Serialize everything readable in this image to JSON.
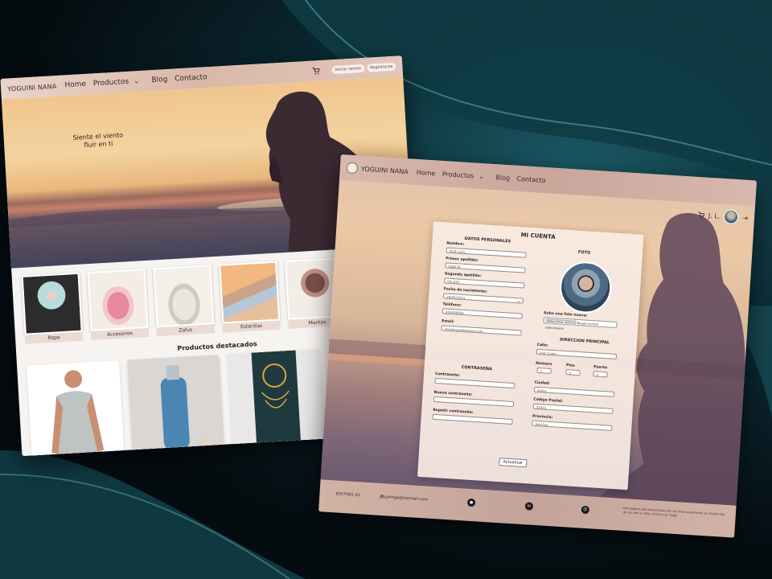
{
  "home": {
    "brand": "YOGUINI NANA",
    "nav": {
      "home": "Home",
      "productos": "Productos",
      "blog": "Blog",
      "contacto": "Contacto"
    },
    "login": "Iniciar sesion",
    "register": "Registrarse",
    "tagline_1": "Siente el viento",
    "tagline_2": "fluir en ti",
    "categories": [
      "Ropa",
      "Accesorios",
      "Zafus",
      "Esterillas",
      "Mantas"
    ],
    "featured_title": "Productos destacados"
  },
  "account": {
    "brand": "YOGUINI NANA",
    "nav": {
      "home": "Home",
      "productos": "Productos",
      "blog": "Blog",
      "contacto": "Contacto"
    },
    "user_initials": "J. L.",
    "title": "MI CUENTA",
    "personal": {
      "title": "DATOS PERSONALES",
      "nombre_label": "Nombre:",
      "nombre_value": "JOSE LUIS",
      "apellido1_label": "Primer apellido:",
      "apellido1_value": "GARCIA",
      "apellido2_label": "Segundo apellido:",
      "apellido2_value": "PELAYO",
      "nacimiento_label": "Fecha de nacimiento:",
      "nacimiento_value": "28/05/2024",
      "telefono_label": "Teléfono:",
      "telefono_value": "645698956",
      "email_label": "Email:",
      "email_value": "jlscplmga@hotmail.com"
    },
    "foto": {
      "title": "FOTO",
      "upload_label": "Sube una foto nueva:",
      "file_button": "Seleccionar archivo",
      "file_text": "Ningún archivo seleccionado"
    },
    "password": {
      "title": "CONTRASEÑA",
      "current_label": "Contraseña:",
      "new_label": "Nueva contraseña:",
      "repeat_label": "Repetir contraseña:"
    },
    "address": {
      "title": "DIRECCION PRINCIPAL",
      "calle_label": "Calle:",
      "calle_placeholder": "Jose Cueto",
      "numero_label": "Número",
      "numero_value": "3",
      "piso_label": "Piso",
      "piso_value": "d",
      "puerta_label": "Puerta",
      "puerta_value": "d",
      "ciudad_label": "Ciudad:",
      "ciudad_value": "Aviles",
      "cp_label": "Código Postal:",
      "cp_value": "33401",
      "provincia_label": "Provincia:",
      "provincia_value": "Asturias"
    },
    "update_button": "Actualizar",
    "footer": {
      "phone": "6557965 43",
      "email": "jlscplmga@hotmail.com",
      "note": "Esta página está desarrollada solo con fines académicos sin ningún tipo de uso real en ellos. Utilice a su riesgo"
    }
  },
  "colors": {
    "accent": "#d9b8a8",
    "background": "#0b2a33"
  }
}
